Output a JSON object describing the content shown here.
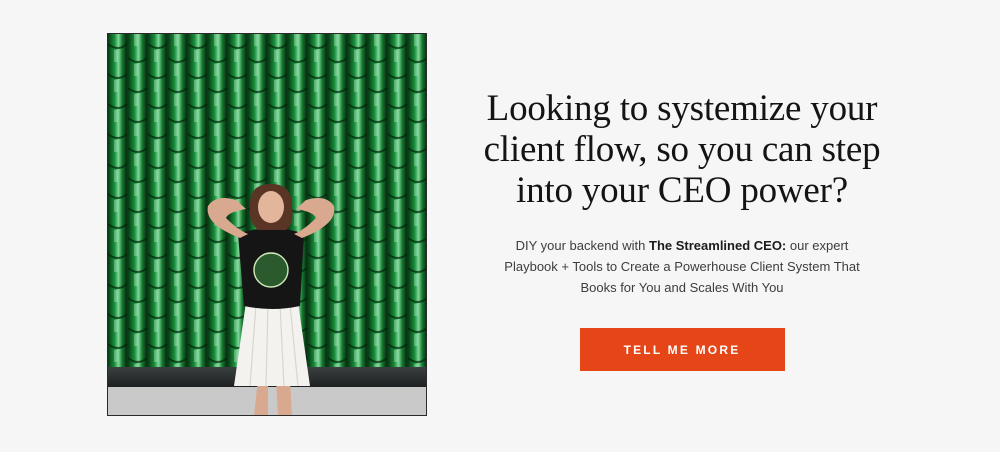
{
  "hero": {
    "image_alt": "Woman in a black graphic t-shirt and white pleated skirt posing in front of a green glass tile wall",
    "headline": "Looking to systemize your client flow, so you can step into your CEO power?",
    "subtext": {
      "before": "DIY your backend with ",
      "bold": "The Streamlined CEO:",
      "after": " our expert Playbook + Tools to Create a Powerhouse Client System That Books for You and Scales With You"
    },
    "cta_label": "TELL ME MORE"
  },
  "colors": {
    "background": "#f6f6f6",
    "cta": "#e64517",
    "wall_green": "#137a33"
  }
}
